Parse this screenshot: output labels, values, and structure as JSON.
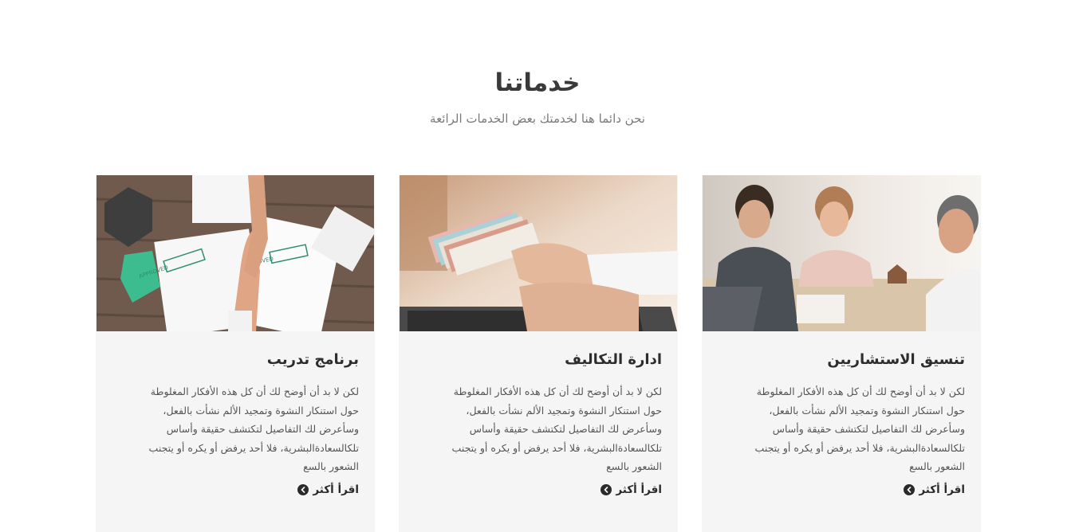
{
  "section": {
    "title": "خدماتنا",
    "subtitle": "نحن دائما هنا لخدمتك بعض الخدمات الرائعة"
  },
  "cards": [
    {
      "title": "تنسيق الاستشاريين",
      "text_lines": [
        "لكن لا بد أن أوضح لك أن كل هذه الأفكار المغلوطة",
        "حول استنكار النشوة وتمجيد الألم نشأت بالفعل،",
        "وسأعرض لك التفاصيل لتكتشف حقيقة وأساس",
        "تلكالسعادةالبشرية، فلا أحد يرفض أو يكره أو يتجنب",
        "الشعور بالسع"
      ],
      "link": "اقرأ أكثر",
      "image": "consultants-meeting-photo"
    },
    {
      "title": "ادارة التكاليف",
      "text_lines": [
        "لكن لا بد أن أوضح لك أن كل هذه الأفكار المغلوطة",
        "حول استنكار النشوة وتمجيد الألم نشأت بالفعل،",
        "وسأعرض لك التفاصيل لتكتشف حقيقة وأساس",
        "تلكالسعادةالبشرية، فلا أحد يرفض أو يكره أو يتجنب",
        "الشعور بالسع"
      ],
      "link": "اقرأ أكثر",
      "image": "money-laptop-photo"
    },
    {
      "title": "برنامج تدريب",
      "text_lines": [
        "لكن لا بد أن أوضح لك أن كل هذه الأفكار المغلوطة",
        "حول استنكار النشوة وتمجيد الألم نشأت بالفعل،",
        "وسأعرض لك التفاصيل لتكتشف حقيقة وأساس",
        "تلكالسعادةالبشرية، فلا أحد يرفض أو يكره أو يتجنب",
        "الشعور بالسع"
      ],
      "link": "اقرأ أكثر",
      "image": "handshake-documents-photo",
      "stamp_text": "APPROVED"
    }
  ],
  "colors": {
    "card_bg": "#f5f5f5",
    "title": "#3a3a3a",
    "subtitle": "#7a7a7a",
    "body_text": "#555555"
  }
}
